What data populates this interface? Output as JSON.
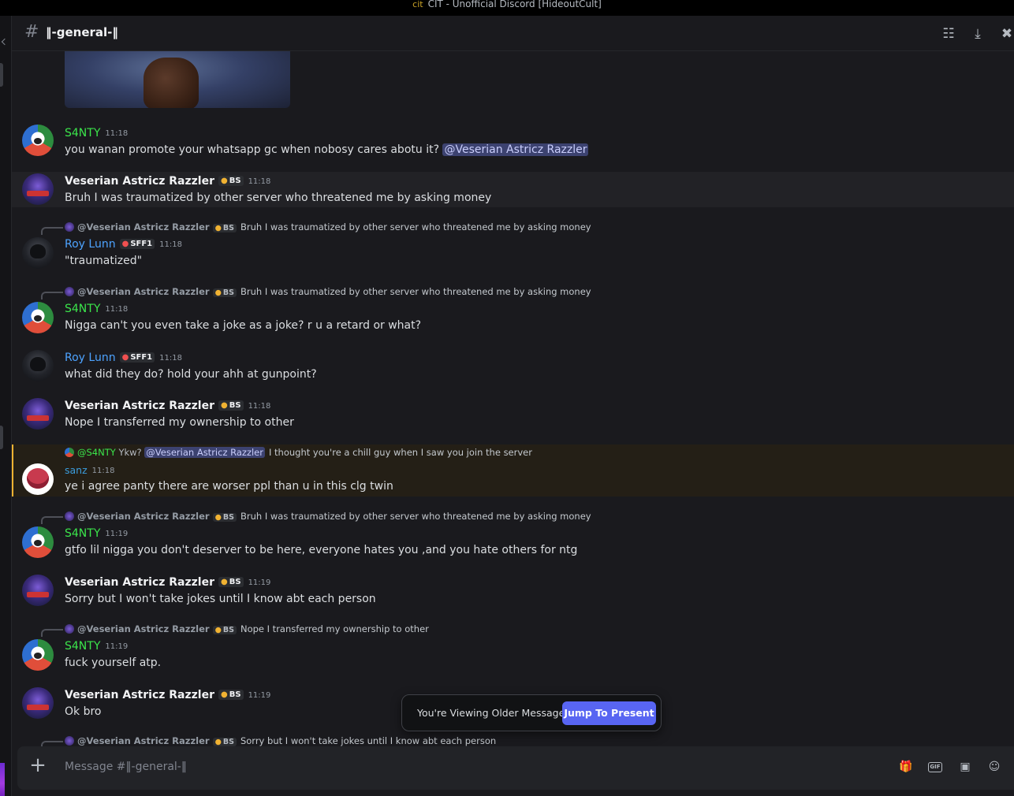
{
  "window": {
    "title": "CIT - Unofficial Discord [HideoutCult]",
    "logo_glyph": "cit"
  },
  "channel": {
    "hash": "#",
    "name": "‖-general-‖"
  },
  "header_icons": [
    "threads-icon",
    "mute-icon",
    "pin-icon"
  ],
  "messages": [
    {
      "author": "S4NTY",
      "time": "11:18",
      "text": "you wanan promote your whatsapp gc when nobosy cares abotu it?",
      "mention": "@Veserian Astricz Razzler"
    },
    {
      "author": "Veserian Astricz Razzler",
      "badge": "BS",
      "time": "11:18",
      "text": "Bruh I was traumatized by other server who threatened me by asking money"
    },
    {
      "reply": {
        "name": "@Veserian Astricz Razzler",
        "badge": "BS",
        "text": "Bruh I was traumatized by other server who threatened me by asking money"
      },
      "author": "Roy Lunn",
      "badge": "SFF1",
      "time": "11:18",
      "text": "\"traumatized\""
    },
    {
      "reply": {
        "name": "@Veserian Astricz Razzler",
        "badge": "BS",
        "text": "Bruh I was traumatized by other server who threatened me by asking money"
      },
      "author": "S4NTY",
      "time": "11:18",
      "text": "Nigga can't you even take a joke as a joke? r u a retard or what?"
    },
    {
      "author": "Roy Lunn",
      "badge": "SFF1",
      "time": "11:18",
      "text": "what did they do? hold your ahh at gunpoint?"
    },
    {
      "author": "Veserian Astricz Razzler",
      "badge": "BS",
      "time": "11:18",
      "text": "Nope I transferred my ownership to other"
    },
    {
      "reply": {
        "name": "@S4NTY",
        "pre": "Ykw?",
        "mention": "@Veserian Astricz Razzler",
        "text": "I thought you're a chill guy when I saw you join the server"
      },
      "author": "sanz",
      "time": "11:18",
      "text": "ye i agree panty there are worser ppl than u in this clg twin"
    },
    {
      "reply": {
        "name": "@Veserian Astricz Razzler",
        "badge": "BS",
        "text": "Bruh I was traumatized by other server who threatened me by asking money"
      },
      "author": "S4NTY",
      "time": "11:19",
      "text": "gtfo lil nigga you don't deserver to be here, everyone hates you ,and you hate others for ntg"
    },
    {
      "author": "Veserian Astricz Razzler",
      "badge": "BS",
      "time": "11:19",
      "text": "Sorry but I won't take jokes until I know abt each person"
    },
    {
      "reply": {
        "name": "@Veserian Astricz Razzler",
        "badge": "BS",
        "text": "Nope I transferred my ownership to other"
      },
      "author": "S4NTY",
      "time": "11:19",
      "text": "fuck yourself atp."
    },
    {
      "author": "Veserian Astricz Razzler",
      "badge": "BS",
      "time": "11:19",
      "text": "Ok bro"
    },
    {
      "reply": {
        "name": "@Veserian Astricz Razzler",
        "badge": "BS",
        "text": "Sorry but I won't take jokes until I know abt each person"
      }
    }
  ],
  "toast": {
    "label": "You're Viewing Older Messages",
    "button": "Jump To Present"
  },
  "composer": {
    "placeholder": "Message #‖-general-‖",
    "icons": [
      "gift-icon",
      "gif-icon",
      "sticker-icon",
      "emoji-icon"
    ],
    "gif_text": "GIF"
  }
}
